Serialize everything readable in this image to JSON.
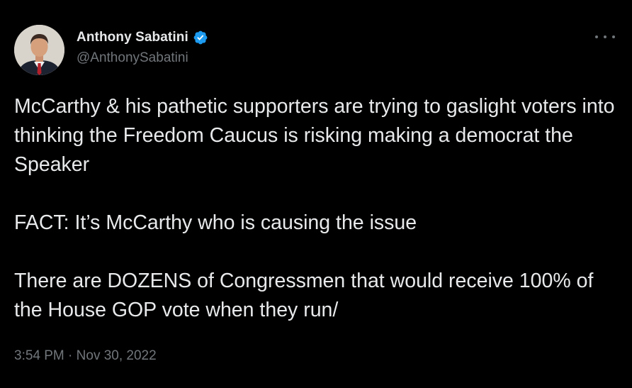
{
  "author": {
    "display_name": "Anthony Sabatini",
    "handle": "@AnthonySabatini",
    "verified": true
  },
  "tweet": {
    "paragraphs": [
      "McCarthy & his pathetic supporters are trying to gaslight voters into thinking the Freedom Caucus is risking making a democrat the Speaker",
      "FACT: It’s McCarthy who is causing the issue",
      "There are DOZENS of Congressmen that would receive 100% of the House GOP vote when they run/"
    ],
    "time": "3:54 PM",
    "separator": "·",
    "date": "Nov 30, 2022"
  },
  "icons": {
    "verified": "verified-badge-icon",
    "more": "more-options-icon"
  },
  "colors": {
    "background": "#000000",
    "primary_text": "#e7e9ea",
    "secondary_text": "#71767b",
    "verified_blue": "#1d9bf0"
  }
}
